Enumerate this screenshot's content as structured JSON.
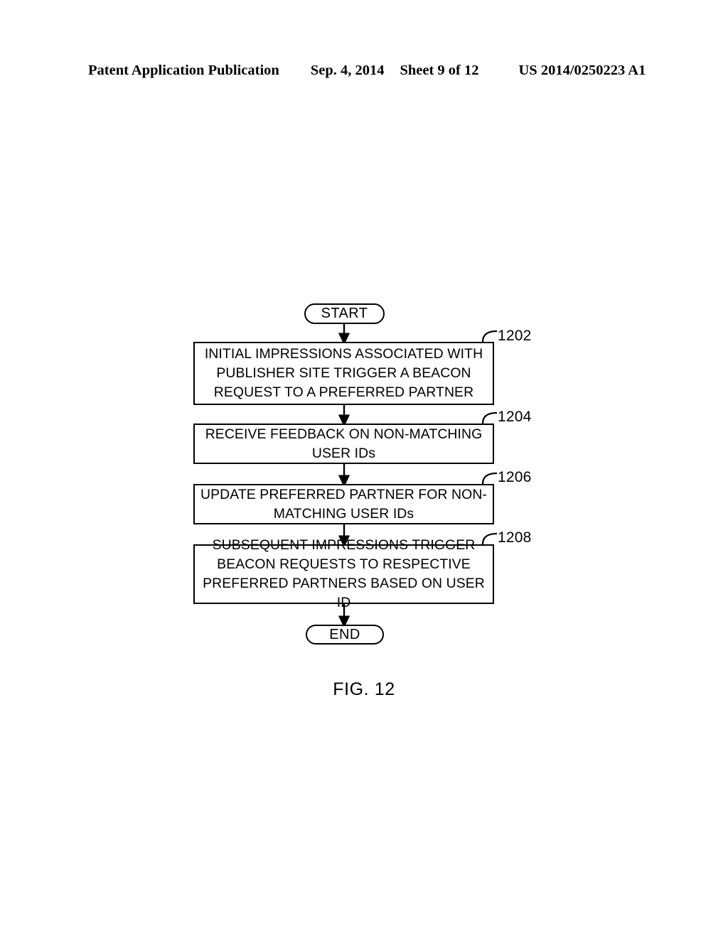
{
  "header": {
    "publication": "Patent Application Publication",
    "date": "Sep. 4, 2014",
    "sheet": "Sheet 9 of 12",
    "patent_number": "US 2014/0250223 A1"
  },
  "figure": {
    "caption": "FIG. 12"
  },
  "flowchart": {
    "start_label": "START",
    "end_label": "END",
    "steps": [
      {
        "ref": "1202",
        "text": "INITIAL IMPRESSIONS ASSOCIATED WITH PUBLISHER SITE TRIGGER A BEACON REQUEST TO A PREFERRED PARTNER"
      },
      {
        "ref": "1204",
        "text": "RECEIVE FEEDBACK ON NON-MATCHING USER IDs"
      },
      {
        "ref": "1206",
        "text": "UPDATE PREFERRED PARTNER FOR NON-MATCHING USER IDs"
      },
      {
        "ref": "1208",
        "text": "SUBSEQUENT IMPRESSIONS TRIGGER BEACON REQUESTS TO RESPECTIVE PREFERRED PARTNERS BASED ON USER ID"
      }
    ]
  },
  "colors": {
    "ink": "#000000",
    "paper": "#ffffff"
  }
}
